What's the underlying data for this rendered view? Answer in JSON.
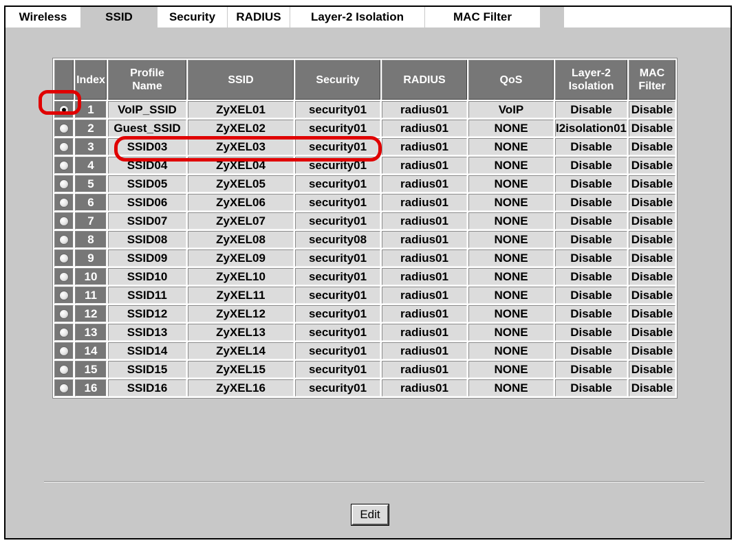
{
  "tabs": [
    {
      "label": "Wireless",
      "active": false
    },
    {
      "label": "SSID",
      "active": true
    },
    {
      "label": "Security",
      "active": false
    },
    {
      "label": "RADIUS",
      "active": false
    },
    {
      "label": "Layer-2 Isolation",
      "active": false
    },
    {
      "label": "MAC Filter",
      "active": false
    }
  ],
  "table": {
    "headers": [
      "",
      "Index",
      "Profile Name",
      "SSID",
      "Security",
      "RADIUS",
      "QoS",
      "Layer-2 Isolation",
      "MAC Filter"
    ],
    "selected_index": "1",
    "rows": [
      {
        "index": "1",
        "profile": "VoIP_SSID",
        "ssid": "ZyXEL01",
        "security": "security01",
        "radius": "radius01",
        "qos": "VoIP",
        "l2": "Disable",
        "mac": "Disable"
      },
      {
        "index": "2",
        "profile": "Guest_SSID",
        "ssid": "ZyXEL02",
        "security": "security01",
        "radius": "radius01",
        "qos": "NONE",
        "l2": "l2isolation01",
        "mac": "Disable"
      },
      {
        "index": "3",
        "profile": "SSID03",
        "ssid": "ZyXEL03",
        "security": "security01",
        "radius": "radius01",
        "qos": "NONE",
        "l2": "Disable",
        "mac": "Disable"
      },
      {
        "index": "4",
        "profile": "SSID04",
        "ssid": "ZyXEL04",
        "security": "security01",
        "radius": "radius01",
        "qos": "NONE",
        "l2": "Disable",
        "mac": "Disable"
      },
      {
        "index": "5",
        "profile": "SSID05",
        "ssid": "ZyXEL05",
        "security": "security01",
        "radius": "radius01",
        "qos": "NONE",
        "l2": "Disable",
        "mac": "Disable"
      },
      {
        "index": "6",
        "profile": "SSID06",
        "ssid": "ZyXEL06",
        "security": "security01",
        "radius": "radius01",
        "qos": "NONE",
        "l2": "Disable",
        "mac": "Disable"
      },
      {
        "index": "7",
        "profile": "SSID07",
        "ssid": "ZyXEL07",
        "security": "security01",
        "radius": "radius01",
        "qos": "NONE",
        "l2": "Disable",
        "mac": "Disable"
      },
      {
        "index": "8",
        "profile": "SSID08",
        "ssid": "ZyXEL08",
        "security": "security08",
        "radius": "radius01",
        "qos": "NONE",
        "l2": "Disable",
        "mac": "Disable"
      },
      {
        "index": "9",
        "profile": "SSID09",
        "ssid": "ZyXEL09",
        "security": "security01",
        "radius": "radius01",
        "qos": "NONE",
        "l2": "Disable",
        "mac": "Disable"
      },
      {
        "index": "10",
        "profile": "SSID10",
        "ssid": "ZyXEL10",
        "security": "security01",
        "radius": "radius01",
        "qos": "NONE",
        "l2": "Disable",
        "mac": "Disable"
      },
      {
        "index": "11",
        "profile": "SSID11",
        "ssid": "ZyXEL11",
        "security": "security01",
        "radius": "radius01",
        "qos": "NONE",
        "l2": "Disable",
        "mac": "Disable"
      },
      {
        "index": "12",
        "profile": "SSID12",
        "ssid": "ZyXEL12",
        "security": "security01",
        "radius": "radius01",
        "qos": "NONE",
        "l2": "Disable",
        "mac": "Disable"
      },
      {
        "index": "13",
        "profile": "SSID13",
        "ssid": "ZyXEL13",
        "security": "security01",
        "radius": "radius01",
        "qos": "NONE",
        "l2": "Disable",
        "mac": "Disable"
      },
      {
        "index": "14",
        "profile": "SSID14",
        "ssid": "ZyXEL14",
        "security": "security01",
        "radius": "radius01",
        "qos": "NONE",
        "l2": "Disable",
        "mac": "Disable"
      },
      {
        "index": "15",
        "profile": "SSID15",
        "ssid": "ZyXEL15",
        "security": "security01",
        "radius": "radius01",
        "qos": "NONE",
        "l2": "Disable",
        "mac": "Disable"
      },
      {
        "index": "16",
        "profile": "SSID16",
        "ssid": "ZyXEL16",
        "security": "security01",
        "radius": "radius01",
        "qos": "NONE",
        "l2": "Disable",
        "mac": "Disable"
      }
    ]
  },
  "edit_label": "Edit",
  "colors": {
    "highlight": "#e00000",
    "panel": "#c8c8c8",
    "header": "#777777",
    "cell": "#dcdcdc"
  }
}
